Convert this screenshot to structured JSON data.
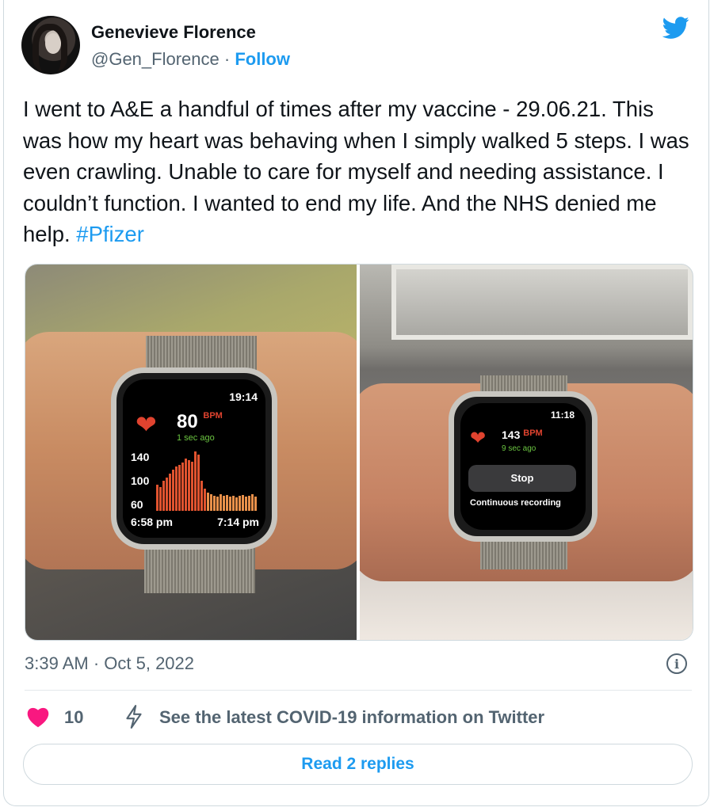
{
  "author": {
    "name": "Genevieve Florence",
    "handle": "@Gen_Florence",
    "separator": "·",
    "follow_label": "Follow"
  },
  "tweet": {
    "text": "I went to A&E a handful of times after my vaccine - 29.06.21. This was how my heart was behaving when I simply walked 5 steps. I was even crawling. Unable to care for myself and needing assistance. I couldn’t function. I wanted to end my life. And the NHS denied me help. ",
    "hashtag": "#Pfizer"
  },
  "media": {
    "left_watch": {
      "time": "19:14",
      "bpm": "80",
      "bpm_unit": "BPM",
      "ago": "1 sec ago",
      "y_labels": [
        "140",
        "100",
        "60"
      ],
      "x_start": "6:58 pm",
      "x_end": "7:14 pm",
      "heart_rate_bars": [
        95,
        92,
        100,
        105,
        110,
        115,
        120,
        122,
        125,
        130,
        128,
        126,
        140,
        135,
        100,
        90,
        84,
        82,
        80,
        79,
        82,
        80,
        81,
        79,
        80,
        78,
        80,
        81,
        79,
        80,
        82,
        79
      ]
    },
    "right_watch": {
      "time": "11:18",
      "bpm": "143",
      "bpm_unit": "BPM",
      "ago": "9 sec ago",
      "stop_label": "Stop",
      "recording_label": "Continuous recording"
    }
  },
  "meta": {
    "timestamp": "3:39 AM · Oct 5, 2022",
    "info_glyph": "i"
  },
  "actions": {
    "like_count": "10",
    "covid_info": "See the latest COVID-19 information on Twitter",
    "read_replies": "Read 2 replies"
  },
  "colors": {
    "accent": "#1d9bf0",
    "like": "#f91880",
    "muted": "#536471",
    "watch_red": "#e0432f",
    "watch_green": "#6bc541"
  }
}
